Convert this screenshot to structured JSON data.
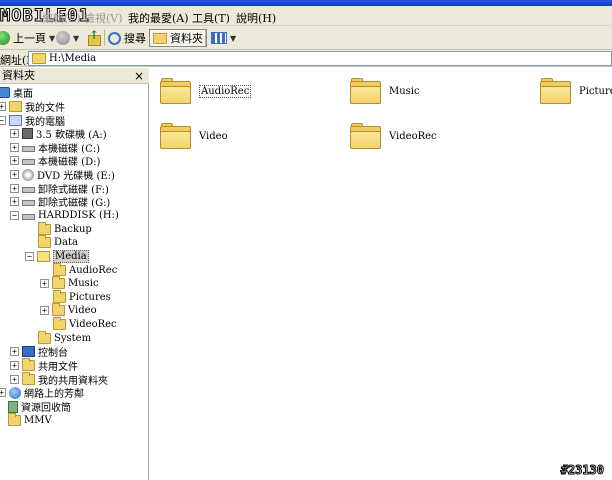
{
  "brand": {
    "logo_text": "MOBILE01"
  },
  "menubar": {
    "items": [
      {
        "label": "編輯(E)",
        "faded": true
      },
      {
        "label": "檢視(V)",
        "faded": true
      },
      {
        "label": "我的最愛(A)",
        "faded": false
      },
      {
        "label": "工具(T)",
        "faded": false
      },
      {
        "label": "說明(H)",
        "faded": false
      }
    ]
  },
  "toolbar": {
    "back_label": "上一頁",
    "search_label": "搜尋",
    "folders_label": "資料夾"
  },
  "address": {
    "label": "網址(D)",
    "value": "H:\\Media"
  },
  "folders_panel": {
    "title": "資料夾",
    "close": "×"
  },
  "tree": {
    "desktop": "桌面",
    "my_documents": "我的文件",
    "my_computer": "我的電腦",
    "floppy": "3.5 軟碟機 (A:)",
    "disk_c": "本機磁碟 (C:)",
    "disk_d": "本機磁碟 (D:)",
    "dvd_e": "DVD 光碟機 (E:)",
    "removable_f": "卸除式磁碟 (F:)",
    "removable_g": "卸除式磁碟 (G:)",
    "harddisk_h": "HARDDISK (H:)",
    "backup": "Backup",
    "data": "Data",
    "media": "Media",
    "audiorec": "AudioRec",
    "music": "Music",
    "pictures": "Pictures",
    "video": "Video",
    "videorec": "VideoRec",
    "system": "System",
    "control_panel": "控制台",
    "shared_docs": "共用文件",
    "my_shared_folder": "我的共用資料夾",
    "network_places": "網路上的芳鄰",
    "recycle_bin": "資源回收筒",
    "mmv": "MMV"
  },
  "files": [
    "AudioRec",
    "Music",
    "Pictures",
    "Video",
    "VideoRec"
  ],
  "watermark": "#23130"
}
